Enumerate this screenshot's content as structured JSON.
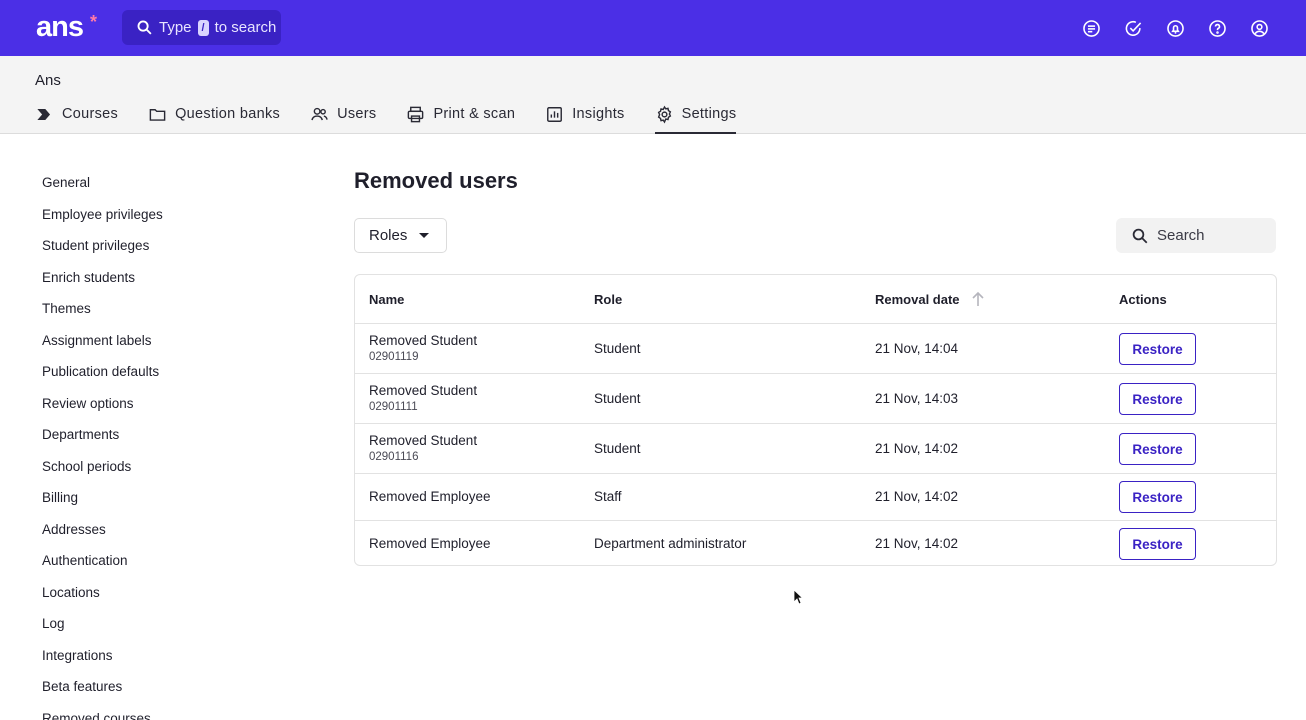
{
  "topbar": {
    "logo": "ans",
    "logo_star": "*",
    "search_prefix": "Type",
    "search_key": "/",
    "search_suffix": "to search",
    "icons": [
      "feedback-icon",
      "check-circle-icon",
      "notification-bell-icon",
      "help-icon",
      "account-icon"
    ]
  },
  "header": {
    "org_name": "Ans",
    "tabs": [
      {
        "label": "Courses",
        "icon": "courses-icon"
      },
      {
        "label": "Question banks",
        "icon": "folder-icon"
      },
      {
        "label": "Users",
        "icon": "users-icon"
      },
      {
        "label": "Print & scan",
        "icon": "printer-icon"
      },
      {
        "label": "Insights",
        "icon": "chart-icon"
      },
      {
        "label": "Settings",
        "icon": "gear-icon",
        "active": true
      }
    ]
  },
  "sidebar": {
    "items": [
      "General",
      "Employee privileges",
      "Student privileges",
      "Enrich students",
      "Themes",
      "Assignment labels",
      "Publication defaults",
      "Review options",
      "Departments",
      "School periods",
      "Billing",
      "Addresses",
      "Authentication",
      "Locations",
      "Log",
      "Integrations",
      "Beta features",
      "Removed courses"
    ]
  },
  "main": {
    "title": "Removed users",
    "roles_filter": "Roles",
    "search_placeholder": "Search",
    "columns": {
      "name": "Name",
      "role": "Role",
      "date": "Removal date",
      "actions": "Actions"
    },
    "rows": [
      {
        "name": "Removed Student",
        "id": "02901119",
        "role": "Student",
        "date": "21 Nov, 14:04",
        "action": "Restore"
      },
      {
        "name": "Removed Student",
        "id": "02901111",
        "role": "Student",
        "date": "21 Nov, 14:03",
        "action": "Restore"
      },
      {
        "name": "Removed Student",
        "id": "02901116",
        "role": "Student",
        "date": "21 Nov, 14:02",
        "action": "Restore"
      },
      {
        "name": "Removed Employee",
        "id": "",
        "role": "Staff",
        "date": "21 Nov, 14:02",
        "action": "Restore"
      },
      {
        "name": "Removed Employee",
        "id": "",
        "role": "Department administrator",
        "date": "21 Nov, 14:02",
        "action": "Restore"
      }
    ]
  },
  "colors": {
    "brand": "#4b2fe6",
    "accent": "#3a22c4"
  }
}
